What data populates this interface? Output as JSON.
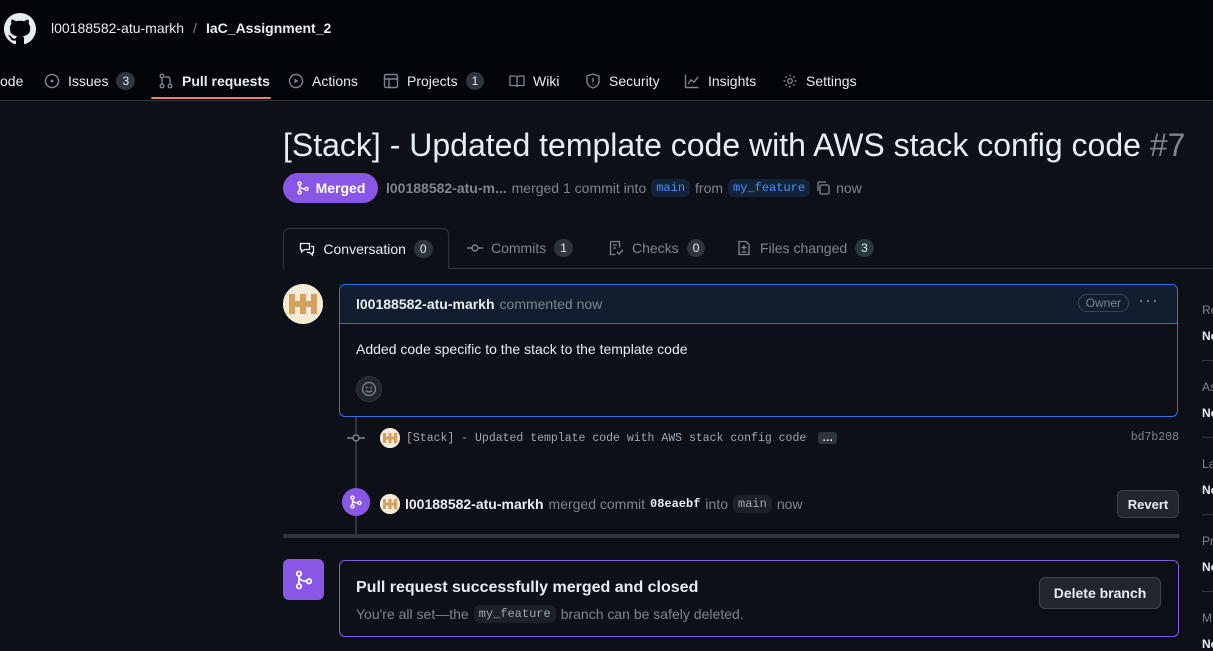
{
  "repo": {
    "owner": "l00188582-atu-markh",
    "separator": "/",
    "name": "IaC_Assignment_2"
  },
  "nav": {
    "code": "ode",
    "issues": "Issues",
    "issues_count": "3",
    "pulls": "Pull requests",
    "actions": "Actions",
    "projects": "Projects",
    "projects_count": "1",
    "wiki": "Wiki",
    "security": "Security",
    "insights": "Insights",
    "settings": "Settings"
  },
  "pr": {
    "title": "[Stack] - Updated template code with AWS stack config code",
    "number": "#7",
    "state": "Merged",
    "author_short": "l00188582-atu-m...",
    "merged_text": "merged 1 commit into",
    "base": "main",
    "from_text": "from",
    "head": "my_feature",
    "time": "now"
  },
  "tabs": {
    "conversation": "Conversation",
    "conversation_count": "0",
    "commits": "Commits",
    "commits_count": "1",
    "checks": "Checks",
    "checks_count": "0",
    "files": "Files changed",
    "files_count": "3"
  },
  "comment": {
    "author": "l00188582-atu-markh",
    "action": "commented now",
    "badge": "Owner",
    "menu": "···",
    "body": "Added code specific to the stack to the template code"
  },
  "commit": {
    "message": "[Stack] - Updated template code with AWS stack config code",
    "ellipsis": "…",
    "sha": "bd7b208"
  },
  "merge_event": {
    "author": "l00188582-atu-markh",
    "text": "merged commit",
    "sha": "08eaebf",
    "into": "into",
    "branch": "main",
    "time": "now",
    "revert": "Revert"
  },
  "merged_box": {
    "title": "Pull request successfully merged and closed",
    "sub_prefix": "You're all set—the",
    "branch": "my_feature",
    "sub_suffix": "branch can be safely deleted.",
    "delete": "Delete branch"
  },
  "sidebar": {
    "items": [
      {
        "label": "Re",
        "value": "No"
      },
      {
        "label": "As",
        "value": "No"
      },
      {
        "label": "La",
        "value": "No"
      },
      {
        "label": "Pr",
        "value": "No"
      },
      {
        "label": "M",
        "value": "No"
      }
    ]
  },
  "colors": {
    "accent_merged": "#8957e5",
    "bg": "#0d1117",
    "header": "#010409",
    "underline": "#f78166"
  }
}
